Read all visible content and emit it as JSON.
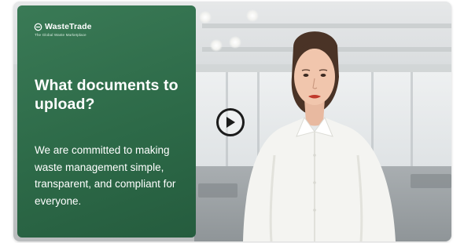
{
  "card": {
    "brand": "WasteTrade",
    "tagline": "The Global Waste Marketplace",
    "heading": "What documents to upload?",
    "body": "We are committed to making waste management simple, transparent, and compliant for everyone.",
    "background_color": "#2d6a48"
  },
  "player": {
    "play_icon": "play-icon"
  }
}
